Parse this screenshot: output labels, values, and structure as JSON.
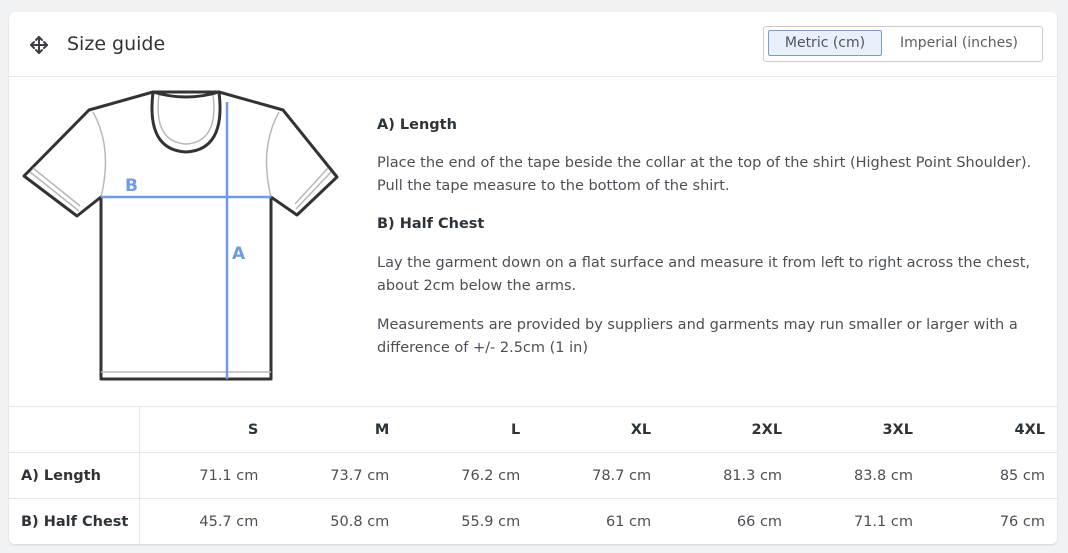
{
  "header": {
    "title": "Size guide",
    "move_icon": "move-arrows-icon",
    "units": {
      "metric": "Metric (cm)",
      "imperial": "Imperial (inches)",
      "selected": "metric"
    }
  },
  "diagram": {
    "label_a": "A",
    "label_b": "B",
    "accent_color": "#6f9be6"
  },
  "description": {
    "length_heading": "A) Length",
    "length_text": "Place the end of the tape beside the collar at the top of the shirt (Highest Point Shoulder). Pull the tape measure to the bottom of the shirt.",
    "chest_heading": "B) Half Chest",
    "chest_text": "Lay the garment down on a flat surface and measure it from left to right across the chest, about 2cm below the arms.",
    "note": "Measurements are provided by suppliers and garments may run smaller or larger with a difference of +/- 2.5cm (1 in)"
  },
  "size_table": {
    "columns": [
      "S",
      "M",
      "L",
      "XL",
      "2XL",
      "3XL",
      "4XL"
    ],
    "rows": [
      {
        "label": "A) Length",
        "values": [
          "71.1 cm",
          "73.7 cm",
          "76.2 cm",
          "78.7 cm",
          "81.3 cm",
          "83.8 cm",
          "85 cm"
        ]
      },
      {
        "label": "B) Half Chest",
        "values": [
          "45.7 cm",
          "50.8 cm",
          "55.9 cm",
          "61 cm",
          "66 cm",
          "71.1 cm",
          "76 cm"
        ]
      }
    ]
  }
}
